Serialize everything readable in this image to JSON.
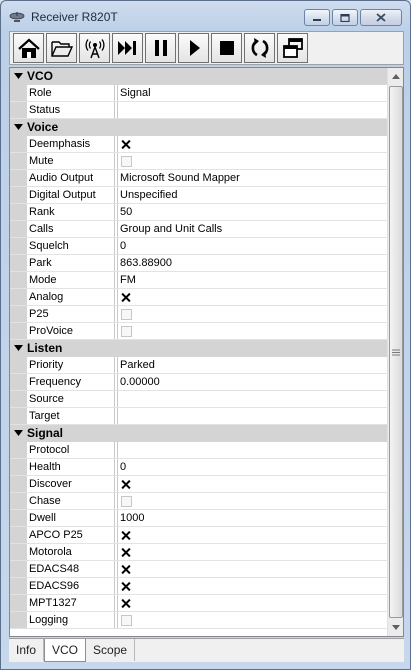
{
  "window": {
    "title": "Receiver R820T",
    "icon": "satellite-dish-icon"
  },
  "toolbar": {
    "buttons": [
      {
        "name": "home-icon"
      },
      {
        "name": "folder-open-icon"
      },
      {
        "name": "antenna-broadcast-icon"
      },
      {
        "name": "skip-next-icon"
      },
      {
        "name": "pause-icon"
      },
      {
        "name": "play-icon"
      },
      {
        "name": "stop-icon"
      },
      {
        "name": "refresh-icon"
      },
      {
        "name": "windows-icon"
      }
    ]
  },
  "categories": [
    {
      "label": "VCO",
      "rows": [
        {
          "name": "Role",
          "value": "Signal"
        },
        {
          "name": "Status",
          "value": ""
        }
      ]
    },
    {
      "label": "Voice",
      "rows": [
        {
          "name": "Deemphasis",
          "check": true
        },
        {
          "name": "Mute",
          "check": false
        },
        {
          "name": "Audio Output",
          "value": "Microsoft Sound Mapper"
        },
        {
          "name": "Digital Output",
          "value": "Unspecified"
        },
        {
          "name": "Rank",
          "value": "50"
        },
        {
          "name": "Calls",
          "value": "Group and Unit Calls"
        },
        {
          "name": "Squelch",
          "value": "0"
        },
        {
          "name": "Park",
          "value": "863.88900"
        },
        {
          "name": "Mode",
          "value": "FM"
        },
        {
          "name": "Analog",
          "check": true
        },
        {
          "name": "P25",
          "check": false
        },
        {
          "name": "ProVoice",
          "check": false
        }
      ]
    },
    {
      "label": "Listen",
      "rows": [
        {
          "name": "Priority",
          "value": "Parked"
        },
        {
          "name": "Frequency",
          "value": "0.00000"
        },
        {
          "name": "Source",
          "value": ""
        },
        {
          "name": "Target",
          "value": ""
        }
      ]
    },
    {
      "label": "Signal",
      "rows": [
        {
          "name": "Protocol",
          "value": ""
        },
        {
          "name": "Health",
          "value": "0"
        },
        {
          "name": "Discover",
          "check": true
        },
        {
          "name": "Chase",
          "check": false
        },
        {
          "name": "Dwell",
          "value": "1000"
        },
        {
          "name": "APCO P25",
          "check": true
        },
        {
          "name": "Motorola",
          "check": true
        },
        {
          "name": "EDACS48",
          "check": true
        },
        {
          "name": "EDACS96",
          "check": true
        },
        {
          "name": "MPT1327",
          "check": true
        },
        {
          "name": "Logging",
          "check": false
        }
      ]
    }
  ],
  "tabs": [
    {
      "label": "Info",
      "active": false
    },
    {
      "label": "VCO",
      "active": true
    },
    {
      "label": "Scope",
      "active": false
    }
  ]
}
